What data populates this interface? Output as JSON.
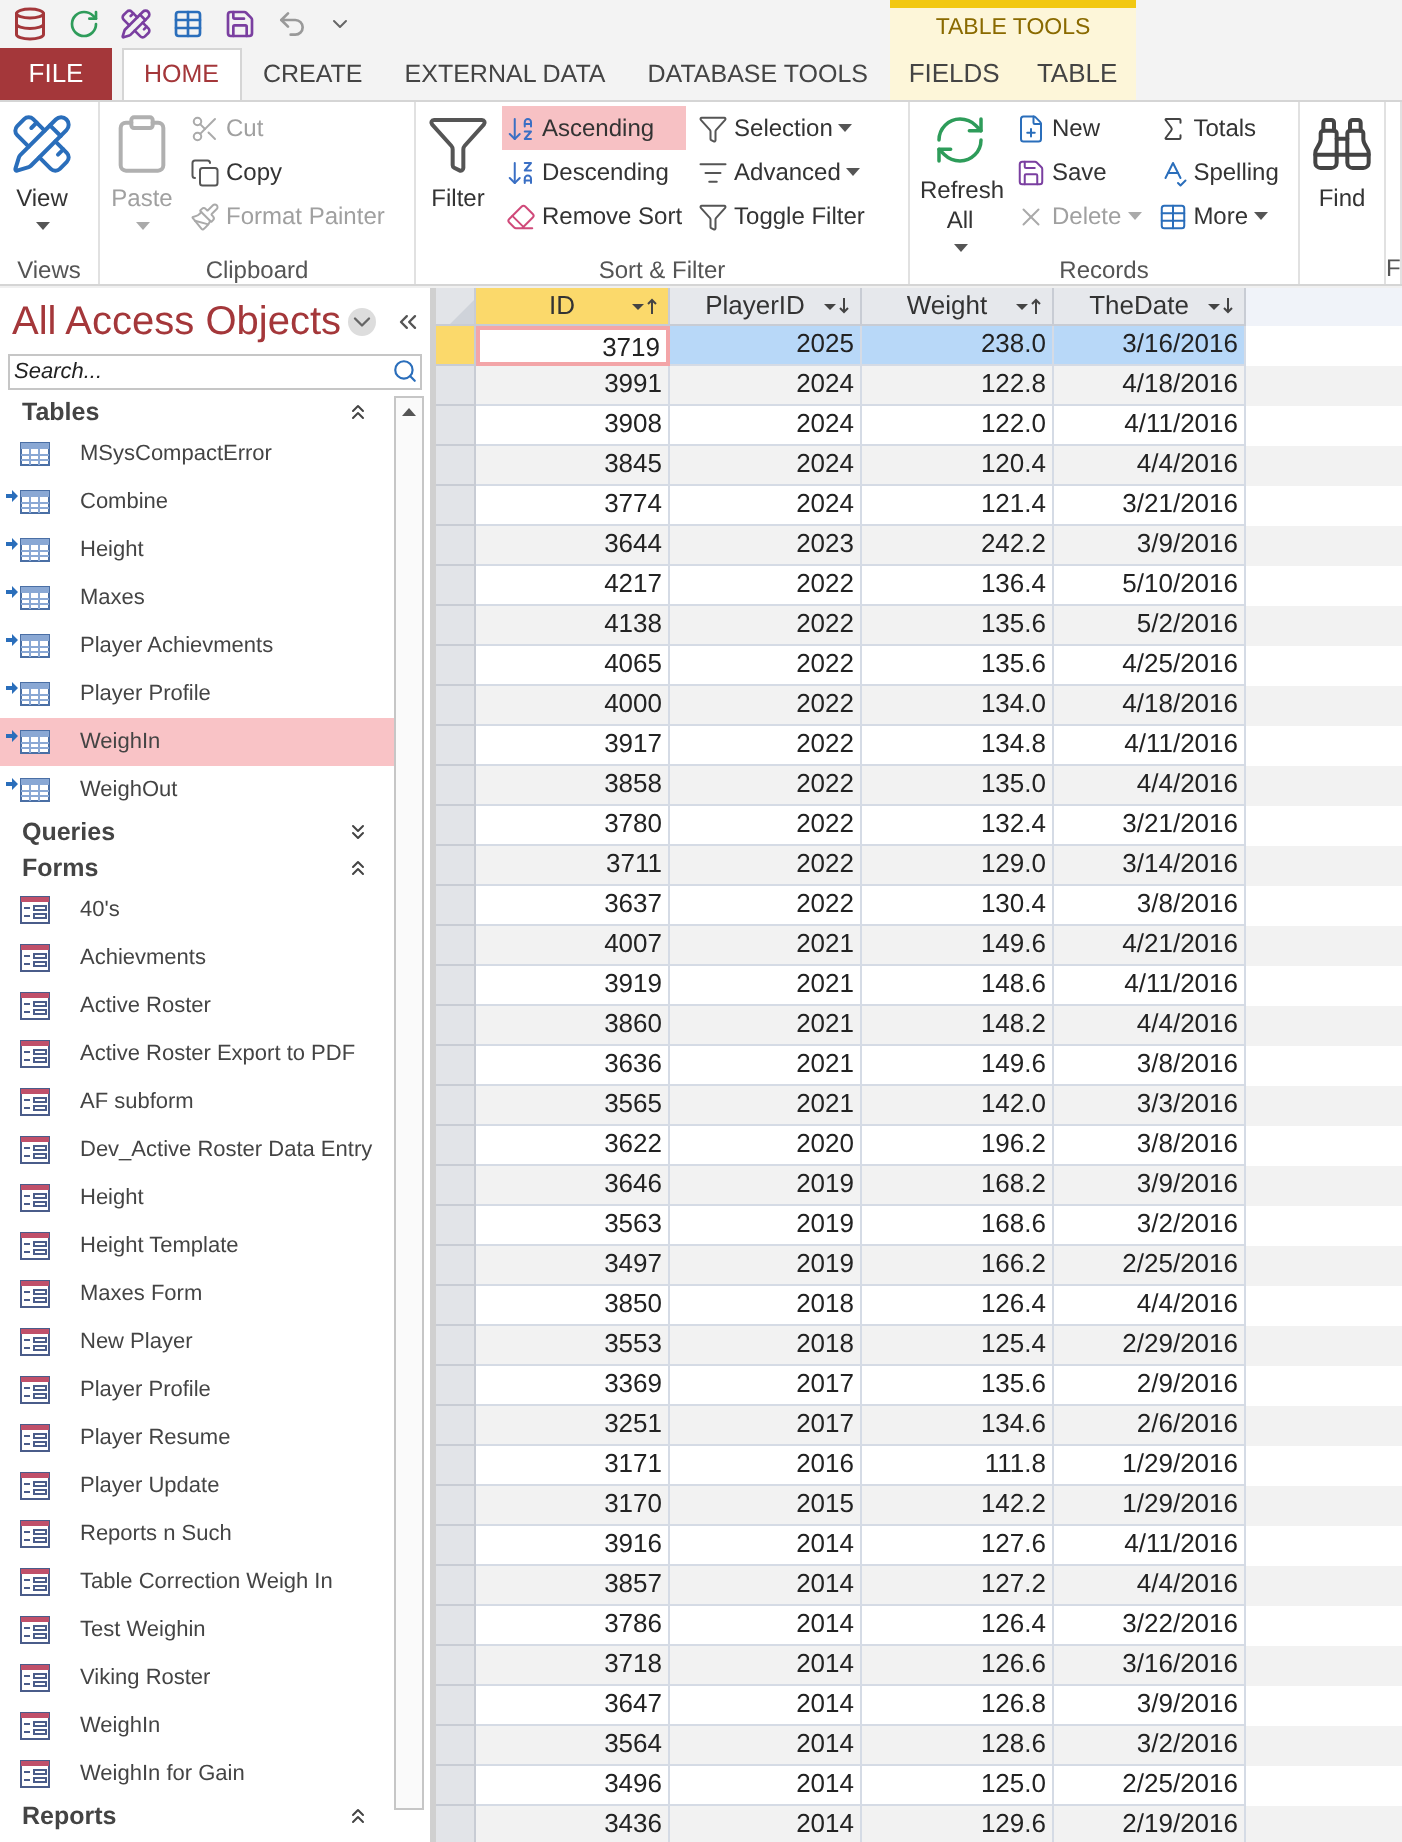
{
  "tabs": [
    {
      "label": "FILE",
      "kind": "file",
      "selected": false
    },
    {
      "label": "HOME",
      "kind": "tab",
      "selected": true
    },
    {
      "label": "CREATE",
      "kind": "tab",
      "selected": false
    },
    {
      "label": "EXTERNAL DATA",
      "kind": "tab",
      "selected": false
    },
    {
      "label": "DATABASE TOOLS",
      "kind": "tab",
      "selected": false
    }
  ],
  "contextual_tabs": {
    "title": "TABLE TOOLS",
    "tabs": [
      {
        "label": "FIELDS",
        "selected": false
      },
      {
        "label": "TABLE",
        "selected": false
      }
    ]
  },
  "ribbon": [
    {
      "label": "Views",
      "items": [
        {
          "kind": "large",
          "label": "View",
          "dropdown": true,
          "disabled": false
        }
      ]
    },
    {
      "label": "Clipboard",
      "items": [
        {
          "kind": "large",
          "label": "Paste",
          "dropdown": true,
          "disabled": true
        },
        {
          "kind": "column",
          "buttons": [
            {
              "label": "Cut",
              "disabled": true,
              "selected": false,
              "dropdown": false
            },
            {
              "label": "Copy",
              "disabled": false,
              "selected": false,
              "dropdown": false
            },
            {
              "label": "Format Painter",
              "disabled": true,
              "selected": false,
              "dropdown": false
            }
          ]
        }
      ]
    },
    {
      "label": "Sort & Filter",
      "items": [
        {
          "kind": "large",
          "label": "Filter",
          "dropdown": false,
          "disabled": false
        },
        {
          "kind": "column",
          "buttons": [
            {
              "label": "Ascending",
              "disabled": false,
              "selected": true,
              "dropdown": false
            },
            {
              "label": "Descending",
              "disabled": false,
              "selected": false,
              "dropdown": false
            },
            {
              "label": "Remove Sort",
              "disabled": false,
              "selected": false,
              "dropdown": false
            }
          ]
        },
        {
          "kind": "column",
          "buttons": [
            {
              "label": "Selection",
              "disabled": false,
              "selected": false,
              "dropdown": true
            },
            {
              "label": "Advanced",
              "disabled": false,
              "selected": false,
              "dropdown": true
            },
            {
              "label": "Toggle Filter",
              "disabled": false,
              "selected": false,
              "dropdown": false
            }
          ]
        }
      ]
    },
    {
      "label": "Records",
      "items": [
        {
          "kind": "large",
          "label": "Refresh All",
          "dropdown": true,
          "disabled": false
        },
        {
          "kind": "column",
          "buttons": [
            {
              "label": "New",
              "disabled": false,
              "selected": false,
              "dropdown": false
            },
            {
              "label": "Save",
              "disabled": false,
              "selected": false,
              "dropdown": false
            },
            {
              "label": "Delete",
              "disabled": true,
              "selected": false,
              "dropdown": true
            }
          ]
        },
        {
          "kind": "column",
          "buttons": [
            {
              "label": "Totals",
              "disabled": false,
              "selected": false,
              "dropdown": false
            },
            {
              "label": "Spelling",
              "disabled": false,
              "selected": false,
              "dropdown": false
            },
            {
              "label": "More",
              "disabled": false,
              "selected": false,
              "dropdown": true
            }
          ]
        }
      ]
    },
    {
      "items": [
        {
          "kind": "large",
          "label": "Find",
          "dropdown": false,
          "disabled": false
        }
      ]
    },
    {
      "label": "F"
    }
  ],
  "nav": {
    "title": "All Access Objects",
    "search": {
      "placeholder": "Search..."
    },
    "sections": [
      {
        "label": "Tables",
        "expanded": true,
        "items": [
          {
            "label": "MSysCompactError",
            "kind": "table",
            "linked": false,
            "selected": false
          },
          {
            "label": "Combine",
            "kind": "table",
            "linked": true,
            "selected": false
          },
          {
            "label": "Height",
            "kind": "table",
            "linked": true,
            "selected": false
          },
          {
            "label": "Maxes",
            "kind": "table",
            "linked": true,
            "selected": false
          },
          {
            "label": "Player Achievments",
            "kind": "table",
            "linked": true,
            "selected": false
          },
          {
            "label": "Player Profile",
            "kind": "table",
            "linked": true,
            "selected": false
          },
          {
            "label": "WeighIn",
            "kind": "table",
            "linked": true,
            "selected": true
          },
          {
            "label": "WeighOut",
            "kind": "table",
            "linked": true,
            "selected": false
          }
        ]
      },
      {
        "label": "Queries",
        "expanded": false
      },
      {
        "label": "Forms",
        "expanded": true,
        "items": [
          {
            "label": "40's",
            "kind": "form",
            "selected": false
          },
          {
            "label": "Achievments",
            "kind": "form",
            "selected": false
          },
          {
            "label": "Active Roster",
            "kind": "form",
            "selected": false
          },
          {
            "label": "Active Roster Export to PDF",
            "kind": "form",
            "selected": false
          },
          {
            "label": "AF subform",
            "kind": "form",
            "selected": false
          },
          {
            "label": "Dev_Active Roster Data Entry",
            "kind": "form",
            "selected": false
          },
          {
            "label": "Height",
            "kind": "form",
            "selected": false
          },
          {
            "label": "Height Template",
            "kind": "form",
            "selected": false
          },
          {
            "label": "Maxes Form",
            "kind": "form",
            "selected": false
          },
          {
            "label": "New Player",
            "kind": "form",
            "selected": false
          },
          {
            "label": "Player Profile",
            "kind": "form",
            "selected": false
          },
          {
            "label": "Player Resume",
            "kind": "form",
            "selected": false
          },
          {
            "label": "Player Update",
            "kind": "form",
            "selected": false
          },
          {
            "label": "Reports n Such",
            "kind": "form",
            "selected": false
          },
          {
            "label": "Table Correction Weigh In",
            "kind": "form",
            "selected": false
          },
          {
            "label": "Test Weighin",
            "kind": "form",
            "selected": false
          },
          {
            "label": "Viking Roster",
            "kind": "form",
            "selected": false
          },
          {
            "label": "WeighIn",
            "kind": "form",
            "selected": false
          },
          {
            "label": "WeighIn for Gain",
            "kind": "form",
            "selected": false
          }
        ]
      },
      {
        "label": "Reports",
        "expanded": true
      }
    ]
  },
  "table": {
    "columns": [
      {
        "label": "ID",
        "descending": false,
        "selected": true
      },
      {
        "label": "PlayerID",
        "descending": true,
        "selected": false
      },
      {
        "label": "Weight",
        "descending": false,
        "selected": false
      },
      {
        "label": "TheDate",
        "descending": true,
        "selected": false
      }
    ],
    "rows": [
      {
        "selected": true,
        "cells": [
          "3719",
          "2025",
          "238.0",
          "3/16/2016"
        ]
      },
      {
        "selected": false,
        "cells": [
          "3991",
          "2024",
          "122.8",
          "4/18/2016"
        ]
      },
      {
        "selected": false,
        "cells": [
          "3908",
          "2024",
          "122.0",
          "4/11/2016"
        ]
      },
      {
        "selected": false,
        "cells": [
          "3845",
          "2024",
          "120.4",
          "4/4/2016"
        ]
      },
      {
        "selected": false,
        "cells": [
          "3774",
          "2024",
          "121.4",
          "3/21/2016"
        ]
      },
      {
        "selected": false,
        "cells": [
          "3644",
          "2023",
          "242.2",
          "3/9/2016"
        ]
      },
      {
        "selected": false,
        "cells": [
          "4217",
          "2022",
          "136.4",
          "5/10/2016"
        ]
      },
      {
        "selected": false,
        "cells": [
          "4138",
          "2022",
          "135.6",
          "5/2/2016"
        ]
      },
      {
        "selected": false,
        "cells": [
          "4065",
          "2022",
          "135.6",
          "4/25/2016"
        ]
      },
      {
        "selected": false,
        "cells": [
          "4000",
          "2022",
          "134.0",
          "4/18/2016"
        ]
      },
      {
        "selected": false,
        "cells": [
          "3917",
          "2022",
          "134.8",
          "4/11/2016"
        ]
      },
      {
        "selected": false,
        "cells": [
          "3858",
          "2022",
          "135.0",
          "4/4/2016"
        ]
      },
      {
        "selected": false,
        "cells": [
          "3780",
          "2022",
          "132.4",
          "3/21/2016"
        ]
      },
      {
        "selected": false,
        "cells": [
          "3711",
          "2022",
          "129.0",
          "3/14/2016"
        ]
      },
      {
        "selected": false,
        "cells": [
          "3637",
          "2022",
          "130.4",
          "3/8/2016"
        ]
      },
      {
        "selected": false,
        "cells": [
          "4007",
          "2021",
          "149.6",
          "4/21/2016"
        ]
      },
      {
        "selected": false,
        "cells": [
          "3919",
          "2021",
          "148.6",
          "4/11/2016"
        ]
      },
      {
        "selected": false,
        "cells": [
          "3860",
          "2021",
          "148.2",
          "4/4/2016"
        ]
      },
      {
        "selected": false,
        "cells": [
          "3636",
          "2021",
          "149.6",
          "3/8/2016"
        ]
      },
      {
        "selected": false,
        "cells": [
          "3565",
          "2021",
          "142.0",
          "3/3/2016"
        ]
      },
      {
        "selected": false,
        "cells": [
          "3622",
          "2020",
          "196.2",
          "3/8/2016"
        ]
      },
      {
        "selected": false,
        "cells": [
          "3646",
          "2019",
          "168.2",
          "3/9/2016"
        ]
      },
      {
        "selected": false,
        "cells": [
          "3563",
          "2019",
          "168.6",
          "3/2/2016"
        ]
      },
      {
        "selected": false,
        "cells": [
          "3497",
          "2019",
          "166.2",
          "2/25/2016"
        ]
      },
      {
        "selected": false,
        "cells": [
          "3850",
          "2018",
          "126.4",
          "4/4/2016"
        ]
      },
      {
        "selected": false,
        "cells": [
          "3553",
          "2018",
          "125.4",
          "2/29/2016"
        ]
      },
      {
        "selected": false,
        "cells": [
          "3369",
          "2017",
          "135.6",
          "2/9/2016"
        ]
      },
      {
        "selected": false,
        "cells": [
          "3251",
          "2017",
          "134.6",
          "2/6/2016"
        ]
      },
      {
        "selected": false,
        "cells": [
          "3171",
          "2016",
          "111.8",
          "1/29/2016"
        ]
      },
      {
        "selected": false,
        "cells": [
          "3170",
          "2015",
          "142.2",
          "1/29/2016"
        ]
      },
      {
        "selected": false,
        "cells": [
          "3916",
          "2014",
          "127.6",
          "4/11/2016"
        ]
      },
      {
        "selected": false,
        "cells": [
          "3857",
          "2014",
          "127.2",
          "4/4/2016"
        ]
      },
      {
        "selected": false,
        "cells": [
          "3786",
          "2014",
          "126.4",
          "3/22/2016"
        ]
      },
      {
        "selected": false,
        "cells": [
          "3718",
          "2014",
          "126.6",
          "3/16/2016"
        ]
      },
      {
        "selected": false,
        "cells": [
          "3647",
          "2014",
          "126.8",
          "3/9/2016"
        ]
      },
      {
        "selected": false,
        "cells": [
          "3564",
          "2014",
          "128.6",
          "3/2/2016"
        ]
      },
      {
        "selected": false,
        "cells": [
          "3496",
          "2014",
          "125.0",
          "2/25/2016"
        ]
      },
      {
        "selected": false,
        "cells": [
          "3436",
          "2014",
          "129.6",
          "2/19/2016"
        ]
      }
    ]
  }
}
